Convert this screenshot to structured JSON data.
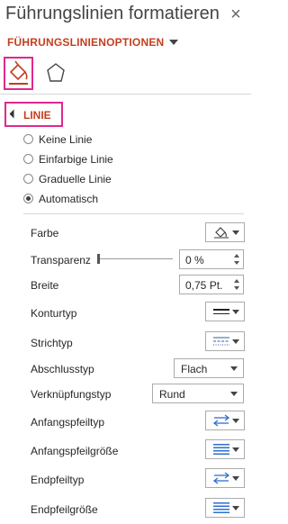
{
  "pane": {
    "title": "Führungslinien formatieren",
    "close_glyph": "×",
    "options_header": "FÜHRUNGSLINIENOPTIONEN"
  },
  "tabs": [
    {
      "icon": "fill-line-icon",
      "selected": true
    },
    {
      "icon": "pentagon-effects-icon",
      "selected": false
    }
  ],
  "section": {
    "label": "LINIE",
    "expanded": true
  },
  "line_options": [
    {
      "label": "Keine Linie",
      "selected": false
    },
    {
      "label": "Einfarbige Linie",
      "selected": false
    },
    {
      "label": "Graduelle Linie",
      "selected": false
    },
    {
      "label": "Automatisch",
      "selected": true
    }
  ],
  "properties": {
    "farbe": {
      "label": "Farbe",
      "icon": "paint-bucket-icon"
    },
    "transparenz": {
      "label": "Transparenz",
      "value": "0 %",
      "slider_fraction": 0.0
    },
    "breite": {
      "label": "Breite",
      "value": "0,75 Pt."
    },
    "konturtyp": {
      "label": "Konturtyp",
      "icon": "compound-type-icon"
    },
    "strichtyp": {
      "label": "Strichtyp",
      "icon": "dash-type-icon"
    },
    "abschlusstyp": {
      "label": "Abschlusstyp",
      "value": "Flach"
    },
    "verknuepfungstyp": {
      "label": "Verknüpfungstyp",
      "value": "Rund"
    },
    "anfangspfeiltyp": {
      "label": "Anfangspfeiltyp",
      "icon": "arrow-type-icon"
    },
    "anfangspfeilgroesse": {
      "label": "Anfangspfeilgröße",
      "icon": "arrow-size-icon"
    },
    "endpfeiltyp": {
      "label": "Endpfeiltyp",
      "icon": "arrow-type-icon"
    },
    "endpfeilgroesse": {
      "label": "Endpfeilgröße",
      "icon": "arrow-size-icon"
    }
  },
  "colors": {
    "accent_orange": "#c43e1c",
    "highlight_pink": "#e0288c"
  }
}
